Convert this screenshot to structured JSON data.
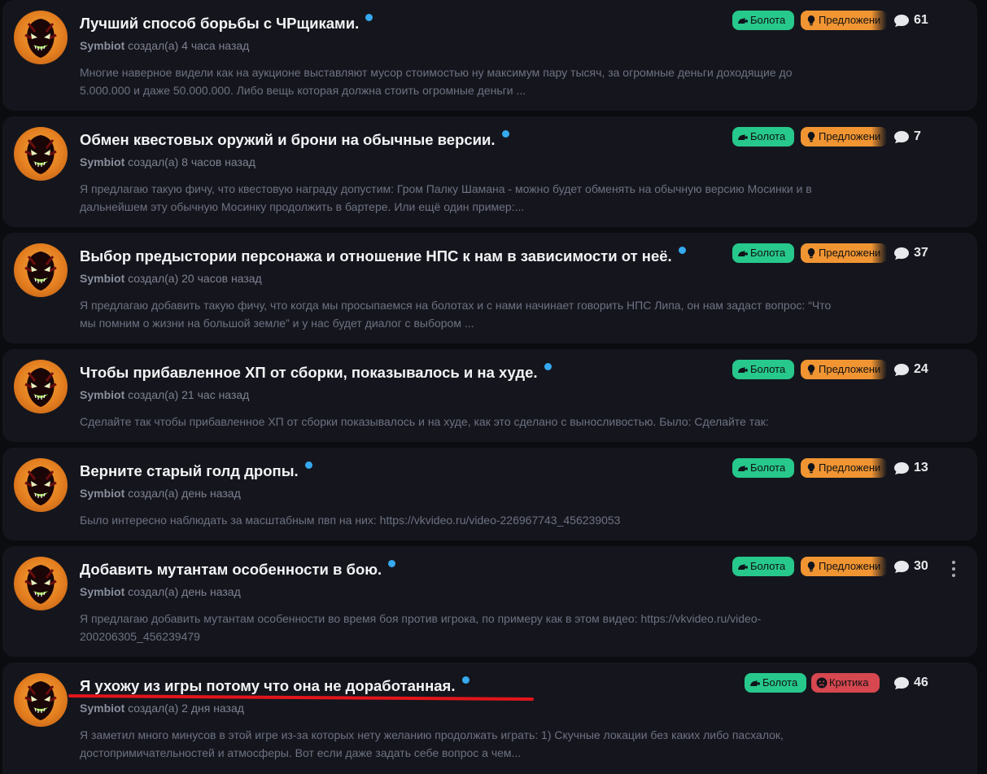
{
  "posts": [
    {
      "title": "Лучший способ борьбы с ЧРщиками.",
      "author": "Symbiot",
      "created": "создал(а) 4 часа назад",
      "excerpt_lines": [
        "Многие наверное видели как на аукционе выставляют мусор стоимостью ну максимум пару тысяч, за огромные деньги доходящие до",
        "5.000.000 и даже 50.000.000. Либо вещь которая должна стоить огромные деньги ..."
      ],
      "tags": [
        {
          "label": "Болота",
          "kind": "green",
          "icon": "frog-icon"
        },
        {
          "label": "Предложени",
          "kind": "orange",
          "icon": "lightbulb-icon"
        }
      ],
      "comments": "61"
    },
    {
      "title": "Обмен квестовых оружий и брони на обычные версии.",
      "author": "Symbiot",
      "created": "создал(а) 8 часов назад",
      "excerpt_lines": [
        "Я предлагаю такую фичу, что квестовую награду допустим: Гром Палку Шамана - можно будет обменять на обычную версию Мосинки и в",
        "дальнейшем эту обычную Мосинку продолжить в бартере. Или ещё один пример:..."
      ],
      "tags": [
        {
          "label": "Болота",
          "kind": "green",
          "icon": "frog-icon"
        },
        {
          "label": "Предложени",
          "kind": "orange",
          "icon": "lightbulb-icon"
        }
      ],
      "comments": "7"
    },
    {
      "title": "Выбор предыстории персонажа и отношение НПС к нам в зависимости от неё.",
      "author": "Symbiot",
      "created": "создал(а) 20 часов назад",
      "excerpt_lines": [
        "Я предлагаю добавить такую фичу, что когда мы просыпаемся на болотах и с нами начинает говорить НПС Липа, он нам задаст вопрос: “Что",
        "мы помним о жизни на большой земле” и у нас будет диалог с выбором ..."
      ],
      "tags": [
        {
          "label": "Болота",
          "kind": "green",
          "icon": "frog-icon"
        },
        {
          "label": "Предложени",
          "kind": "orange",
          "icon": "lightbulb-icon"
        }
      ],
      "comments": "37"
    },
    {
      "title": "Чтобы прибавленное ХП от сборки, показывалось и на худе.",
      "author": "Symbiot",
      "created": "создал(а) 21 час назад",
      "excerpt_lines": [
        "Сделайте так чтобы прибавленное ХП от сборки показывалось и на худе, как это сделано с выносливостью. Было: Сделайте так:"
      ],
      "tags": [
        {
          "label": "Болота",
          "kind": "green",
          "icon": "frog-icon"
        },
        {
          "label": "Предложени",
          "kind": "orange",
          "icon": "lightbulb-icon"
        }
      ],
      "comments": "24"
    },
    {
      "title": "Верните старый голд дропы.",
      "author": "Symbiot",
      "created": "создал(а) день назад",
      "excerpt_lines": [
        "Было интересно наблюдать за масштабным пвп на них: https://vkvideo.ru/video-226967743_456239053"
      ],
      "tags": [
        {
          "label": "Болота",
          "kind": "green",
          "icon": "frog-icon"
        },
        {
          "label": "Предложени",
          "kind": "orange",
          "icon": "lightbulb-icon"
        }
      ],
      "comments": "13"
    },
    {
      "title": "Добавить мутантам особенности в бою.",
      "author": "Symbiot",
      "created": "создал(а) день назад",
      "excerpt_lines": [
        "Я предлагаю добавить мутантам особенности во время боя против игрока, по примеру как в этом видео: https://vkvideo.ru/video-",
        "200206305_456239479"
      ],
      "tags": [
        {
          "label": "Болота",
          "kind": "green",
          "icon": "frog-icon"
        },
        {
          "label": "Предложени",
          "kind": "orange",
          "icon": "lightbulb-icon"
        }
      ],
      "comments": "30"
    },
    {
      "title": "Я ухожу из игры потому что она не доработанная.",
      "author": "Symbiot",
      "created": "создал(а) 2 дня назад",
      "excerpt_lines": [
        "Я заметил много минусов в этой игре из-за которых нету желанию продолжать играть: 1) Скучные локации без каких либо пасхалок,",
        "достопримичательностей и атмосферы. Вот если даже задать себе вопрос а чем..."
      ],
      "tags": [
        {
          "label": "Болота",
          "kind": "green",
          "icon": "frog-icon"
        },
        {
          "label": "Критика",
          "kind": "red",
          "icon": "frown-icon"
        }
      ],
      "comments": "46"
    }
  ],
  "colors": {
    "background": "#0b0c10",
    "card": "#15161d",
    "tag_green": "#27c88c",
    "tag_orange": "#f19533",
    "tag_red": "#d6474f",
    "unread_dot": "#36a9f0",
    "annotation_underline": "#e3151c"
  },
  "icons": {
    "comments": "speech-bubble-icon",
    "more": "kebab-menu-icon",
    "unread": "unread-dot-icon"
  }
}
